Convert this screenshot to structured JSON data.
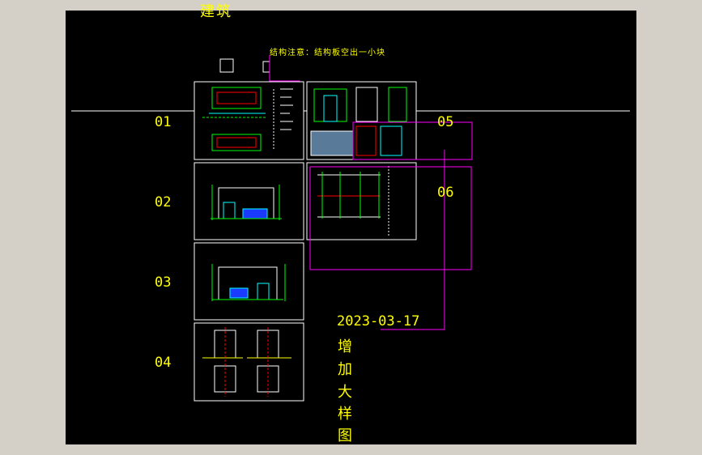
{
  "drawing": {
    "title": "建筑",
    "note": "结构注意：结构板空出一小块",
    "date": "2023-03-17",
    "remark_chars": [
      "增",
      "加",
      "大",
      "样",
      "图"
    ],
    "sheet_labels": [
      "01",
      "02",
      "03",
      "04",
      "05",
      "06"
    ]
  },
  "colors": {
    "background": "#000000",
    "frame": "#ffffff",
    "label": "#ffff00",
    "magenta": "#ff00ff",
    "cyan": "#00ffff",
    "green": "#00ff00",
    "red": "#ff0000"
  }
}
